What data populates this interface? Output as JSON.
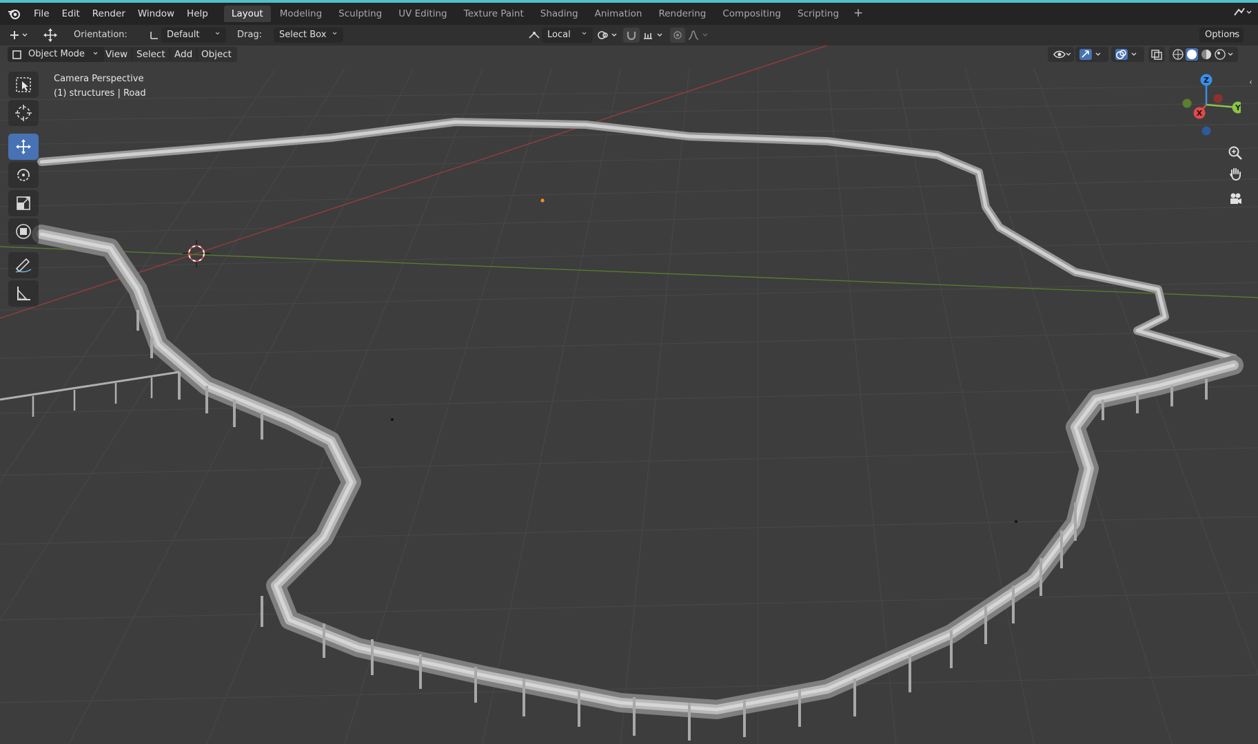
{
  "app": {
    "name": "Blender"
  },
  "menus": [
    {
      "label": "File"
    },
    {
      "label": "Edit"
    },
    {
      "label": "Render"
    },
    {
      "label": "Window"
    },
    {
      "label": "Help"
    }
  ],
  "workspaces": [
    {
      "label": "Layout",
      "active": true
    },
    {
      "label": "Modeling"
    },
    {
      "label": "Sculpting"
    },
    {
      "label": "UV Editing"
    },
    {
      "label": "Texture Paint"
    },
    {
      "label": "Shading"
    },
    {
      "label": "Animation"
    },
    {
      "label": "Rendering"
    },
    {
      "label": "Compositing"
    },
    {
      "label": "Scripting"
    }
  ],
  "workspace_add": "+",
  "tool_header": {
    "orientation_label": "Orientation:",
    "orientation_value": "Default",
    "drag_label": "Drag:",
    "drag_value": "Select Box",
    "pivot_value": "Local",
    "options_label": "Options"
  },
  "viewport_header": {
    "mode": "Object Mode",
    "menus": [
      {
        "label": "View"
      },
      {
        "label": "Select"
      },
      {
        "label": "Add"
      },
      {
        "label": "Object"
      }
    ]
  },
  "viewport": {
    "camera_label": "Camera Perspective",
    "object_label": "(1) structures | Road"
  },
  "gizmo": {
    "z": "Z",
    "y": "Y",
    "x": "X"
  },
  "tools": [
    {
      "name": "select-box-tool"
    },
    {
      "name": "cursor-tool"
    },
    {
      "name": "move-tool",
      "active": true
    },
    {
      "name": "rotate-tool"
    },
    {
      "name": "scale-tool"
    },
    {
      "name": "transform-tool"
    },
    {
      "name": "annotate-tool"
    },
    {
      "name": "measure-tool"
    }
  ],
  "colors": {
    "accent": "#4fc1c9",
    "active_tool": "#4772b3",
    "x_axis": "#e04a4a",
    "y_axis": "#8cc34a",
    "z_axis": "#3b8fe8",
    "viewport_bg": "#3d3d3d"
  }
}
